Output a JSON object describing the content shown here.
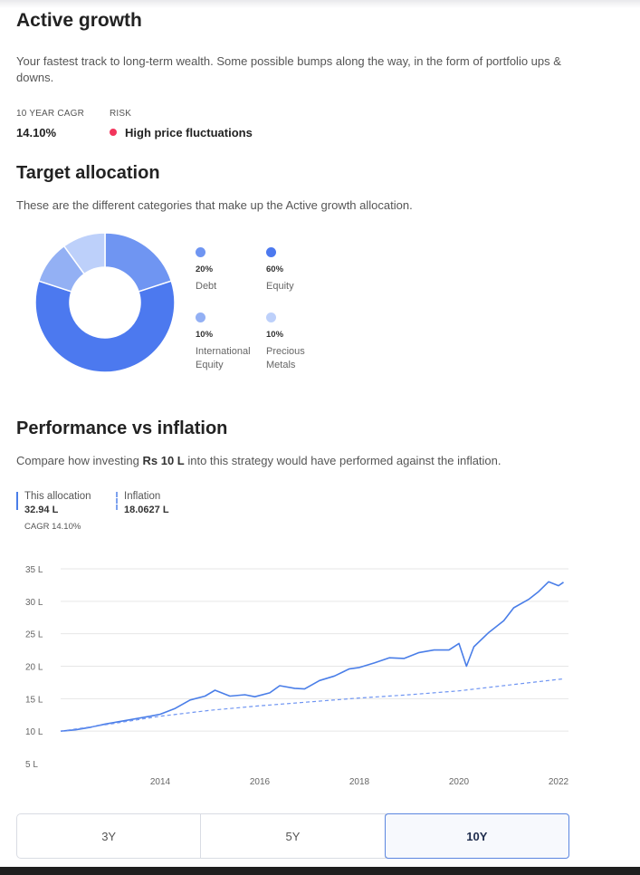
{
  "strategy": {
    "title": "Active growth",
    "description": "Your fastest track to long-term wealth. Some possible bumps along the way, in the form of portfolio ups & downs.",
    "cagr_label": "10 YEAR CAGR",
    "cagr_value": "14.10%",
    "risk_label": "RISK",
    "risk_value": "High price fluctuations",
    "risk_color": "#f2355c"
  },
  "allocation": {
    "title": "Target allocation",
    "description": "These are the different categories that make up the Active growth allocation.",
    "items": [
      {
        "pct_label": "20%",
        "name_line1": "Debt",
        "name_line2": "",
        "value": 20,
        "color": "#6f95f2"
      },
      {
        "pct_label": "60%",
        "name_line1": "Equity",
        "name_line2": "",
        "value": 60,
        "color": "#4c79ef"
      },
      {
        "pct_label": "10%",
        "name_line1": "International",
        "name_line2": "Equity",
        "value": 10,
        "color": "#93b0f4"
      },
      {
        "pct_label": "10%",
        "name_line1": "Precious",
        "name_line2": "Metals",
        "value": 10,
        "color": "#bdd0fa"
      }
    ]
  },
  "performance": {
    "title": "Performance vs inflation",
    "desc_pre": "Compare how investing",
    "desc_amount": "Rs 10 L",
    "desc_post": "into this strategy would have performed against the inflation.",
    "this_label": "This allocation",
    "this_value": "32.94 L",
    "this_cagr": "CAGR 14.10%",
    "inflation_label": "Inflation",
    "inflation_value": "18.0627 L"
  },
  "chart_data": {
    "type": "line",
    "yticks": [
      "35 L",
      "30 L",
      "25 L",
      "20 L",
      "15 L",
      "10 L",
      "5 L"
    ],
    "ytick_values": [
      35,
      30,
      25,
      20,
      15,
      10,
      5
    ],
    "xticks": [
      "2014",
      "2016",
      "2018",
      "2020",
      "2022"
    ],
    "xtick_values": [
      2014,
      2016,
      2018,
      2020,
      2022
    ],
    "xlim": [
      2012.0,
      2022.2
    ],
    "ylim": [
      5,
      35
    ],
    "series": [
      {
        "name": "This allocation",
        "color": "#4a7ee8",
        "style": "solid",
        "x": [
          2012.0,
          2012.3,
          2012.6,
          2012.9,
          2013.2,
          2013.5,
          2013.8,
          2014.0,
          2014.3,
          2014.6,
          2014.9,
          2015.1,
          2015.4,
          2015.7,
          2015.9,
          2016.2,
          2016.4,
          2016.7,
          2016.9,
          2017.2,
          2017.5,
          2017.8,
          2018.0,
          2018.3,
          2018.6,
          2018.9,
          2019.2,
          2019.5,
          2019.8,
          2020.0,
          2020.15,
          2020.3,
          2020.6,
          2020.9,
          2021.1,
          2021.4,
          2021.6,
          2021.8,
          2022.0,
          2022.1
        ],
        "y": [
          10.0,
          10.2,
          10.6,
          11.1,
          11.5,
          11.9,
          12.3,
          12.6,
          13.5,
          14.8,
          15.4,
          16.3,
          15.4,
          15.6,
          15.3,
          15.9,
          17.0,
          16.6,
          16.5,
          17.8,
          18.5,
          19.6,
          19.8,
          20.5,
          21.3,
          21.2,
          22.1,
          22.5,
          22.5,
          23.5,
          20.0,
          23.0,
          25.2,
          27.0,
          29.0,
          30.3,
          31.5,
          33.0,
          32.4,
          32.94
        ]
      },
      {
        "name": "Inflation",
        "color": "#6f95f2",
        "style": "dashed",
        "x": [
          2012.0,
          2013.0,
          2014.0,
          2015.0,
          2016.0,
          2017.0,
          2018.0,
          2019.0,
          2020.0,
          2021.0,
          2022.1
        ],
        "y": [
          10.0,
          11.1,
          12.3,
          13.2,
          13.9,
          14.5,
          15.1,
          15.6,
          16.2,
          17.1,
          18.0627
        ]
      }
    ]
  },
  "periods": {
    "tabs": [
      "3Y",
      "5Y",
      "10Y"
    ],
    "active": "10Y"
  }
}
